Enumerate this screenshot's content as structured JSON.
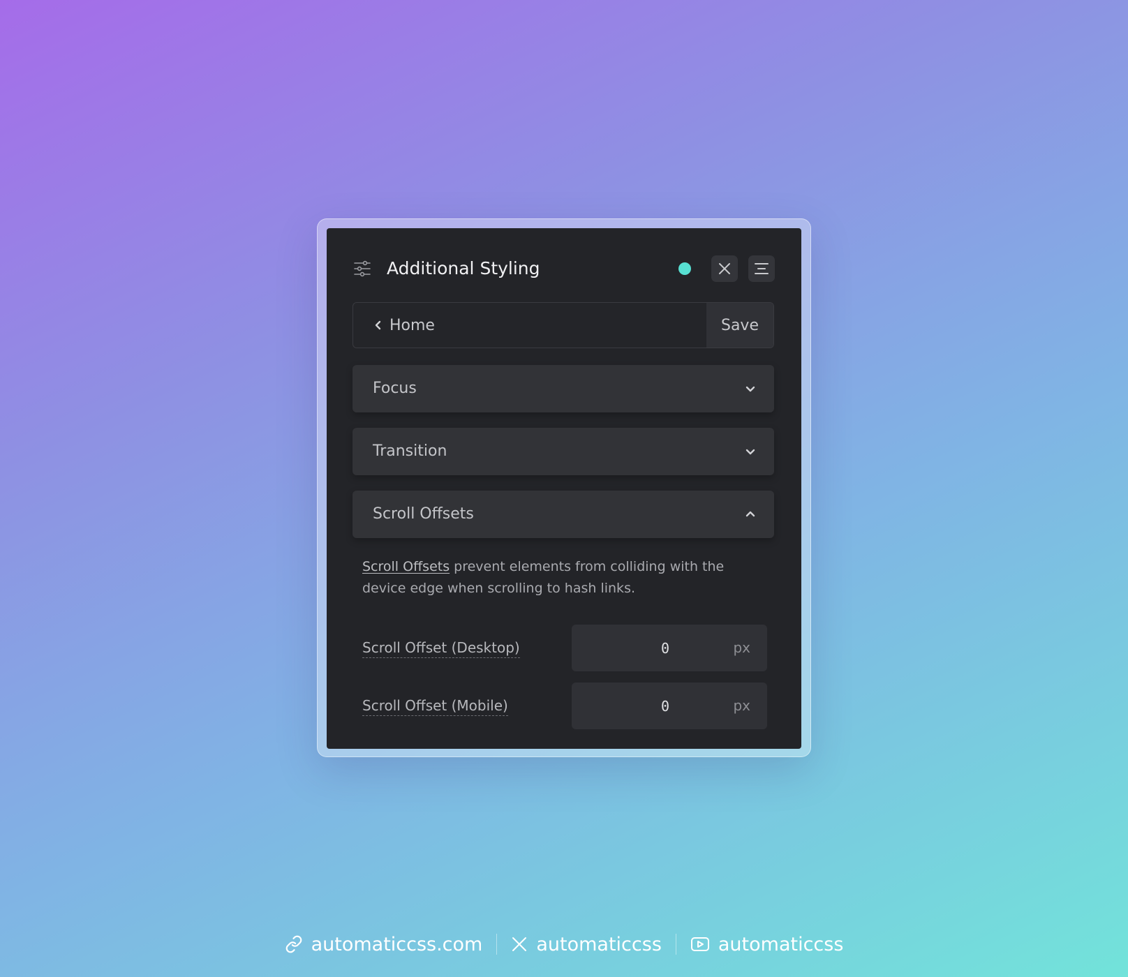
{
  "panel": {
    "title": "Additional Styling",
    "header_icon": "sliders-icon",
    "status_color": "#57e0d2",
    "close_icon": "close-icon",
    "menu_icon": "menu-icon"
  },
  "nav": {
    "back_label": "Home",
    "save_label": "Save"
  },
  "sections": [
    {
      "label": "Focus",
      "state": "collapsed"
    },
    {
      "label": "Transition",
      "state": "collapsed"
    },
    {
      "label": "Scroll Offsets",
      "state": "expanded"
    }
  ],
  "scroll_offsets": {
    "link_text": "Scroll Offsets",
    "description": " prevent elements from colliding with the device edge when scrolling to hash links.",
    "fields": [
      {
        "label": "Scroll Offset (Desktop)",
        "value": "0",
        "unit": "px"
      },
      {
        "label": "Scroll Offset (Mobile)",
        "value": "0",
        "unit": "px"
      }
    ]
  },
  "footer": {
    "website": "automaticcss.com",
    "x_handle": "automaticcss",
    "youtube_handle": "automaticcss"
  }
}
